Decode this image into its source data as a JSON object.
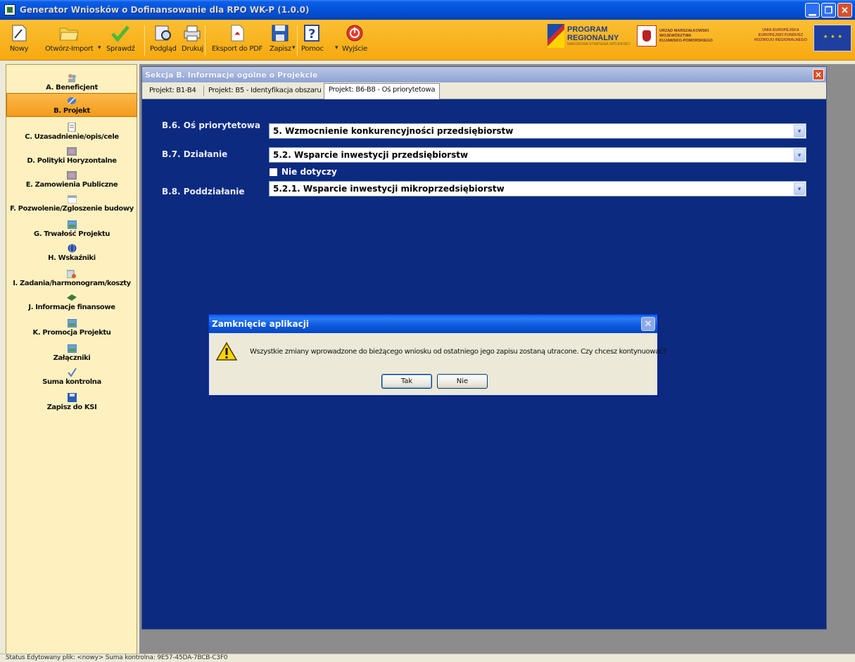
{
  "window": {
    "title": "Generator Wniosków o Dofinansowanie dla RPO WK-P (1.0.0)"
  },
  "toolbar": {
    "items": [
      {
        "label": "Nowy",
        "icon": "new-document-icon"
      },
      {
        "label": "Otwórz-Import",
        "icon": "folder-open-icon"
      },
      {
        "label": "Sprawdź",
        "icon": "checkmark-icon"
      },
      {
        "label": "Podgląd",
        "icon": "preview-icon"
      },
      {
        "label": "Drukuj",
        "icon": "print-icon"
      },
      {
        "label": "Eksport do PDF",
        "icon": "pdf-icon"
      },
      {
        "label": "Zapisz",
        "icon": "save-icon"
      },
      {
        "label": "Pomoc",
        "icon": "help-icon"
      },
      {
        "label": "Wyjście",
        "icon": "exit-icon"
      }
    ],
    "logos": {
      "program_line1": "PROGRAM",
      "program_line2": "REGIONALNY",
      "program_sub": "NARODOWA STRATEGIA SPÓJNOŚCI",
      "um_line1": "URZĄD MARSZAŁKOWSKI",
      "um_line2": "WOJEWÓDZTWA",
      "um_line3": "KUJAWSKO-POMORSKIEGO",
      "ue_line1": "UNIA EUROPEJSKA",
      "ue_line2": "EUROPEJSKI FUNDUSZ",
      "ue_line3": "ROZWOJU REGIONALNEGO"
    }
  },
  "sidebar": {
    "items": [
      {
        "label": "A. Beneficjent",
        "icon": "people-icon",
        "active": false
      },
      {
        "label": "B. Projekt",
        "icon": "tools-icon",
        "active": true
      },
      {
        "label": "C. Uzasadnienie/opis/cele",
        "icon": "document-icon",
        "active": false
      },
      {
        "label": "D. Polityki Horyzontalne",
        "icon": "image-icon",
        "active": false
      },
      {
        "label": "E. Zamowienia Publiczne",
        "icon": "image-icon",
        "active": false
      },
      {
        "label": "F. Pozwolenie/Zgloszenie budowy",
        "icon": "calendar-icon",
        "active": false
      },
      {
        "label": "G. Trwałość Projektu",
        "icon": "picture-icon",
        "active": false
      },
      {
        "label": "H. Wskaźniki",
        "icon": "globe-icon",
        "active": false
      },
      {
        "label": "I. Zadania/harmonogram/koszty",
        "icon": "tasks-icon",
        "active": false
      },
      {
        "label": "J. Informacje finansowe",
        "icon": "money-icon",
        "active": false
      },
      {
        "label": "K. Promocja Projektu",
        "icon": "picture-icon",
        "active": false
      },
      {
        "label": "Załączniki",
        "icon": "picture-icon",
        "active": false
      },
      {
        "label": "Suma kontrolna",
        "icon": "check-icon",
        "active": false
      },
      {
        "label": "Zapisz do KSI",
        "icon": "save-ksi-icon",
        "active": false
      }
    ]
  },
  "section": {
    "title": "Sekcja B. Informacje ogólne o Projekcie",
    "tabs": [
      {
        "label": "Projekt: B1-B4",
        "active": false
      },
      {
        "label": "Projekt: B5 - Identyfikacja obszaru",
        "active": false
      },
      {
        "label": "Projekt: B6-B8 - Oś priorytetowa",
        "active": true
      }
    ],
    "fields": {
      "b6_label": "B.6. Oś priorytetowa",
      "b6_value": "5. Wzmocnienie konkurencyjności przedsiębiorstw",
      "b7_label": "B.7. Działanie",
      "b7_value": "5.2. Wsparcie inwestycji przedsiębiorstw",
      "not_applicable_label": "Nie dotyczy",
      "not_applicable_checked": false,
      "b8_label": "B.8. Poddziałanie",
      "b8_value": "5.2.1. Wsparcie inwestycji mikroprzedsiębiorstw"
    }
  },
  "dialog": {
    "title": "Zamknięcie aplikacji",
    "message": "Wszystkie zmiany wprowadzone do bieżącego wniosku od ostatniego jego zapisu zostaną utracone. Czy chcesz kontynuować?",
    "yes_label": "Tak",
    "no_label": "Nie"
  },
  "status": {
    "text": "Status  Edytowany plik: <nowy>  Suma kontrolna: 9E57-45DA-7BCB-C3F0"
  }
}
